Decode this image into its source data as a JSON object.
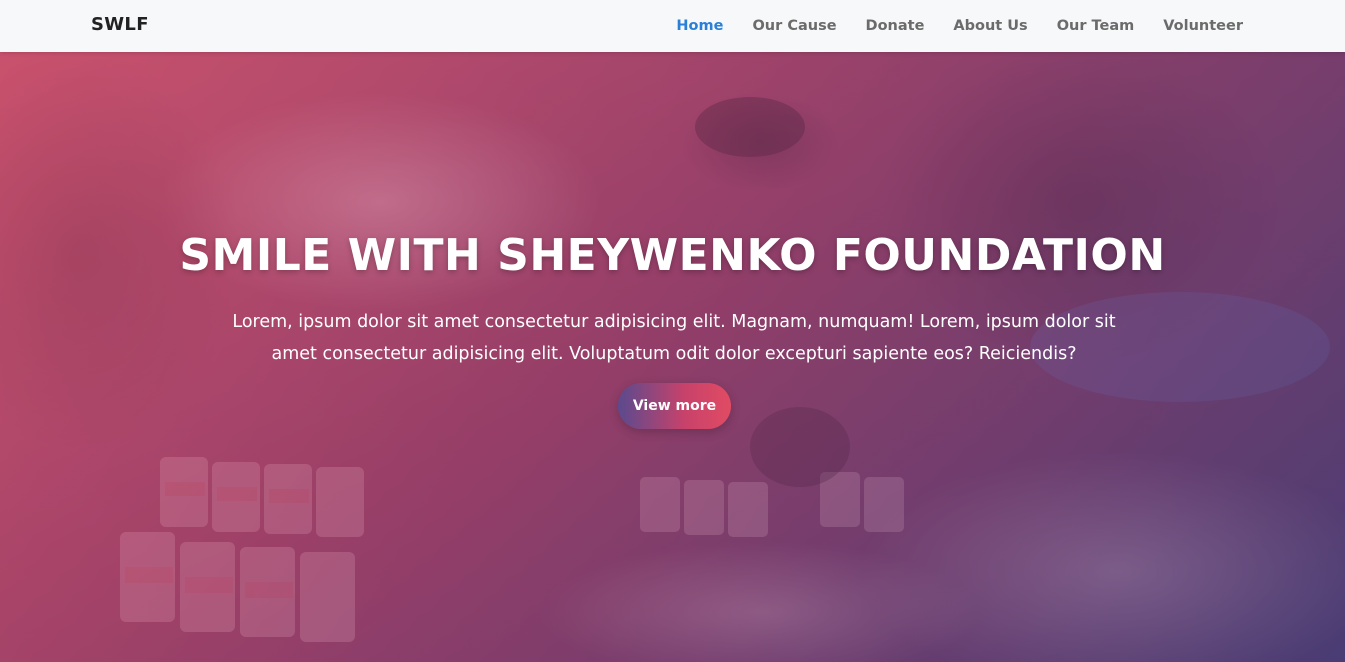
{
  "navbar": {
    "brand": "SWLF",
    "links": [
      {
        "label": "Home",
        "active": true
      },
      {
        "label": "Our Cause",
        "active": false
      },
      {
        "label": "Donate",
        "active": false
      },
      {
        "label": "About Us",
        "active": false
      },
      {
        "label": "Our Team",
        "active": false
      },
      {
        "label": "Volunteer",
        "active": false
      }
    ]
  },
  "hero": {
    "title": "SMILE WITH SHEYWENKO FOUNDATION",
    "text": "Lorem, ipsum dolor sit amet consectetur adipisicing elit. Magnam, numquam! Lorem, ipsum dolor sit amet consectetur adipisicing elit. Voluptatum odit dolor excepturi sapiente eos? Reiciendis?",
    "button_label": "View more"
  },
  "colors": {
    "active_link": "#2a7fd6",
    "nav_link": "#6b6b6b",
    "navbar_bg": "#f7f8fa",
    "button_gradient_start": "#5a4a8e",
    "button_gradient_end": "#e04b63"
  }
}
